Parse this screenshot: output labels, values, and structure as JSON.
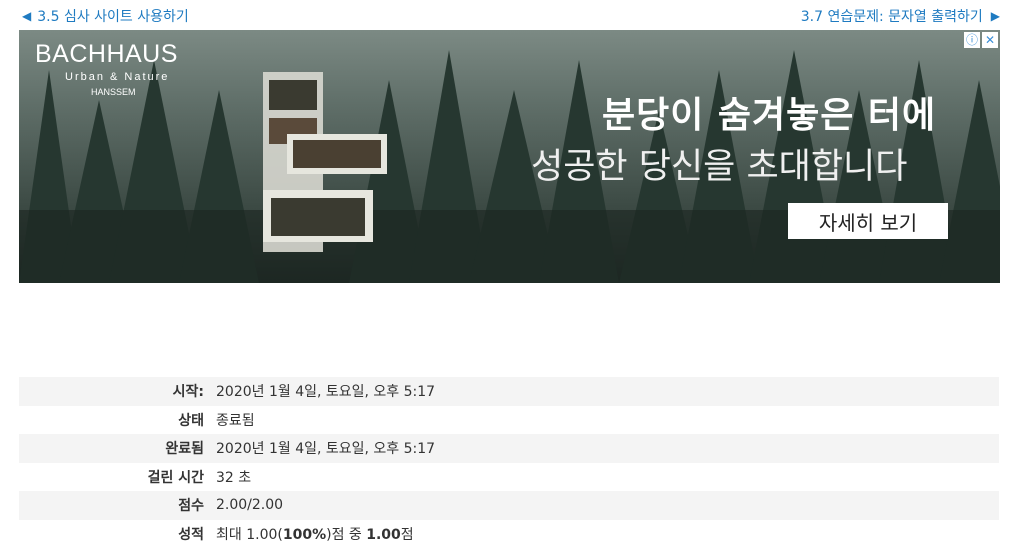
{
  "nav": {
    "prev_label": "3.5 심사 사이트 사용하기",
    "next_label": "3.7 연습문제: 문자열 출력하기",
    "prev_icon": "triangle-left-icon",
    "next_icon": "triangle-right-icon"
  },
  "ad": {
    "brand": "BACHHAUS",
    "brand_sub": "Urban & Nature",
    "brand_small": "HANSSEM",
    "headline": "분당이 숨겨놓은 터에",
    "subline": "성공한 당신을 초대합니다",
    "cta": "자세히 보기",
    "info_icon": "ⓘ",
    "close_icon": "✕"
  },
  "summary": {
    "rows": [
      {
        "label": "시작:",
        "value": "2020년 1월 4일, 토요일, 오후 5:17"
      },
      {
        "label": "상태",
        "value": "종료됨"
      },
      {
        "label": "완료됨",
        "value": "2020년 1월 4일, 토요일, 오후 5:17"
      },
      {
        "label": "걸린 시간",
        "value": "32 초"
      },
      {
        "label": "점수",
        "value": "2.00/2.00"
      },
      {
        "label": "성적",
        "value_parts": [
          "최대 1.00(",
          "100%",
          ")점 중 ",
          "1.00",
          "점"
        ]
      }
    ]
  },
  "colors": {
    "link": "#1f7bc1",
    "row_alt": "#f4f4f4"
  }
}
